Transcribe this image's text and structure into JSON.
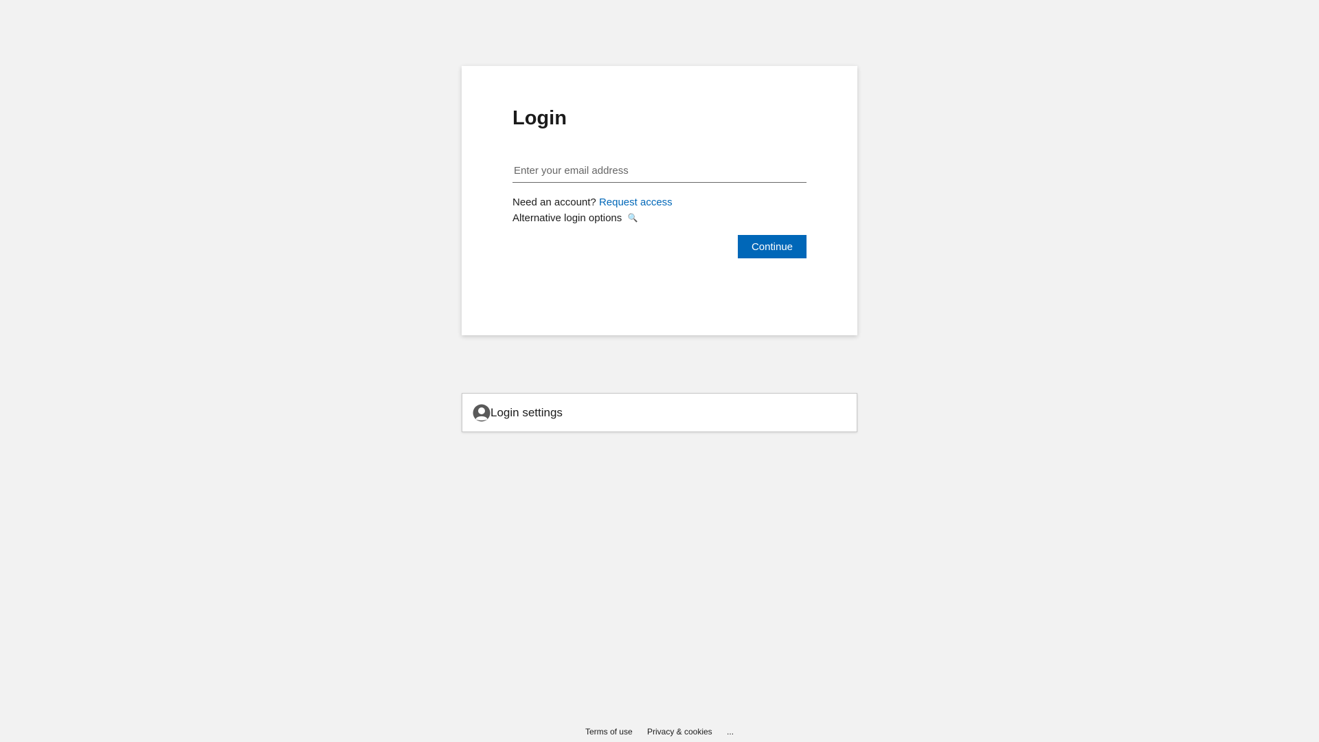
{
  "login": {
    "title": "Login",
    "email_placeholder": "Enter your email address",
    "need_account_text": "Need an account?",
    "request_access_label": "Request access",
    "alt_login_label": "Alternative login options",
    "alt_login_icon": "key-icon",
    "continue_label": "Continue"
  },
  "settings": {
    "icon": "user-icon",
    "label": "Login settings"
  },
  "footer": {
    "terms_label": "Terms of use",
    "privacy_label": "Privacy & cookies",
    "more_label": "..."
  },
  "colors": {
    "background": "#f2f2f2",
    "accent": "#0067b8",
    "text": "#1b1b1b"
  }
}
